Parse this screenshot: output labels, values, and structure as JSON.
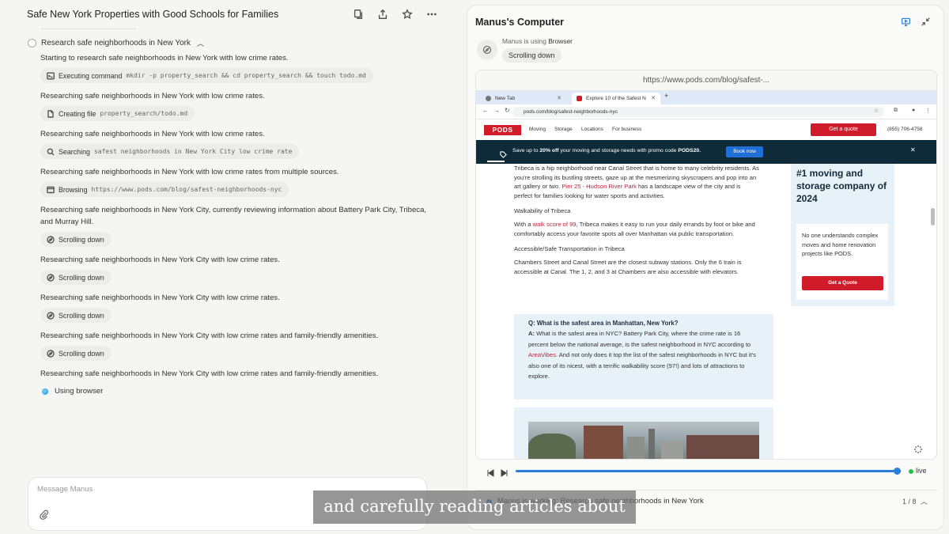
{
  "left": {
    "title": "Safe New York Properties with Good Schools for Families",
    "task_title": "Research safe neighborhoods in New York",
    "log": [
      {
        "msg": "Starting to research safe neighborhoods in New York with low crime rates.",
        "chip_icon": "terminal-icon",
        "chip_label": "Executing command",
        "chip_arg": "mkdir -p property_search && cd property_search && touch todo.md"
      },
      {
        "msg": "Researching safe neighborhoods in New York with low crime rates.",
        "chip_icon": "file-icon",
        "chip_label": "Creating file",
        "chip_arg": "property_search/todo.md"
      },
      {
        "msg": "Researching safe neighborhoods in New York with low crime rates.",
        "chip_icon": "search-icon",
        "chip_label": "Searching",
        "chip_arg": "safest neighborhoods in New York City low crime rate"
      },
      {
        "msg": "Researching safe neighborhoods in New York with low crime rates from multiple sources.",
        "chip_icon": "browser-icon",
        "chip_label": "Browsing",
        "chip_arg": "https://www.pods.com/blog/safest-neighborhoods-nyc"
      },
      {
        "msg": "Researching safe neighborhoods in New York City, currently reviewing information about Battery Park City, Tribeca, and Murray Hill.",
        "chip_icon": "compass-icon",
        "chip_label": "Scrolling down",
        "chip_arg": ""
      },
      {
        "msg": "Researching safe neighborhoods in New York City with low crime rates.",
        "chip_icon": "compass-icon",
        "chip_label": "Scrolling down",
        "chip_arg": ""
      },
      {
        "msg": "Researching safe neighborhoods in New York City with low crime rates.",
        "chip_icon": "compass-icon",
        "chip_label": "Scrolling down",
        "chip_arg": ""
      },
      {
        "msg": "Researching safe neighborhoods in New York City with low crime rates and family-friendly amenities.",
        "chip_icon": "compass-icon",
        "chip_label": "Scrolling down",
        "chip_arg": ""
      }
    ],
    "final_msg": "Researching safe neighborhoods in New York City with low crime rates and family-friendly amenities.",
    "using_label": "Using browser",
    "composer_placeholder": "Message Manus"
  },
  "right": {
    "title": "Manus's Computer",
    "using_prefix": "Manus is using",
    "using_tool": "Browser",
    "status": "Scrolling down",
    "url": "https://www.pods.com/blog/safest-...",
    "browser": {
      "tab1": "New Tab",
      "tab2": "Explore 10 of the Safest N",
      "address": "pods.com/blog/safest-neighborhoods-nyc",
      "logo": "PODS",
      "nav": [
        "Moving",
        "Storage",
        "Locations",
        "For business"
      ],
      "quote_btn": "Get a quote",
      "phone": "(855) 706-4758",
      "promo_pre": "Save up to ",
      "promo_bold": "20% off",
      "promo_mid": " your moving and storage needs with promo code ",
      "promo_code": "PODS20.",
      "promo_btn": "Book now",
      "article": {
        "p1a": "Tribeca is a hip neighborhood near Canal Street that is home to many celebrity residents. As you're strolling its bustling streets, gaze up at the mesmerizing skyscrapers and pop into an art gallery or two. ",
        "p1link": "Pier 25 - Hudson River Park",
        "p1b": " has a landscape view of the city and is perfect for families looking for water sports and activities.",
        "h1": "Walkability of Tribeca",
        "p2a": "With a ",
        "p2link": "walk score of 99",
        "p2b": ", Tribeca makes it easy to run your daily errands by foot or bike and comfortably access your favorite spots all over Manhattan via public transportation.",
        "h2": "Accessible/Safe Transportation in Tribeca",
        "p3": "Chambers Street and Canal Street are the closest subway stations. Only the 6 train is accessible at Canal. The 1, 2, and 3 at Chambers are also accessible with elevators."
      },
      "faq": {
        "q": "Q: What is the safest area in Manhattan, New York?",
        "a_label": "A:",
        "a1": " What is the safest area in NYC? Battery Park City, where the crime rate is 16 percent below the national average, is the safest neighborhood in NYC according to ",
        "a_link": "AreaVibes",
        "a2": ". And not only does it top the list of the safest neighborhoods in NYC but it's also one of its nicest, with a terrific walkability score (97!) and lots of attractions to explore."
      },
      "ad": {
        "headline": "#1 moving and storage company of 2024",
        "body": "No one understands complex moves and home renovation projects like PODS.",
        "button": "Get a Quote"
      }
    },
    "playback": {
      "progress": 0.99,
      "live_label": "live"
    },
    "task_status": "Manus is working: Research safe neighborhoods in New York",
    "task_count": "1 / 8"
  },
  "caption": "and carefully reading articles about",
  "colors": {
    "accent": "#2b7fd9",
    "pods_red": "#d01c2a",
    "promo_bg": "#0f2b3a",
    "live": "#27c04b"
  }
}
